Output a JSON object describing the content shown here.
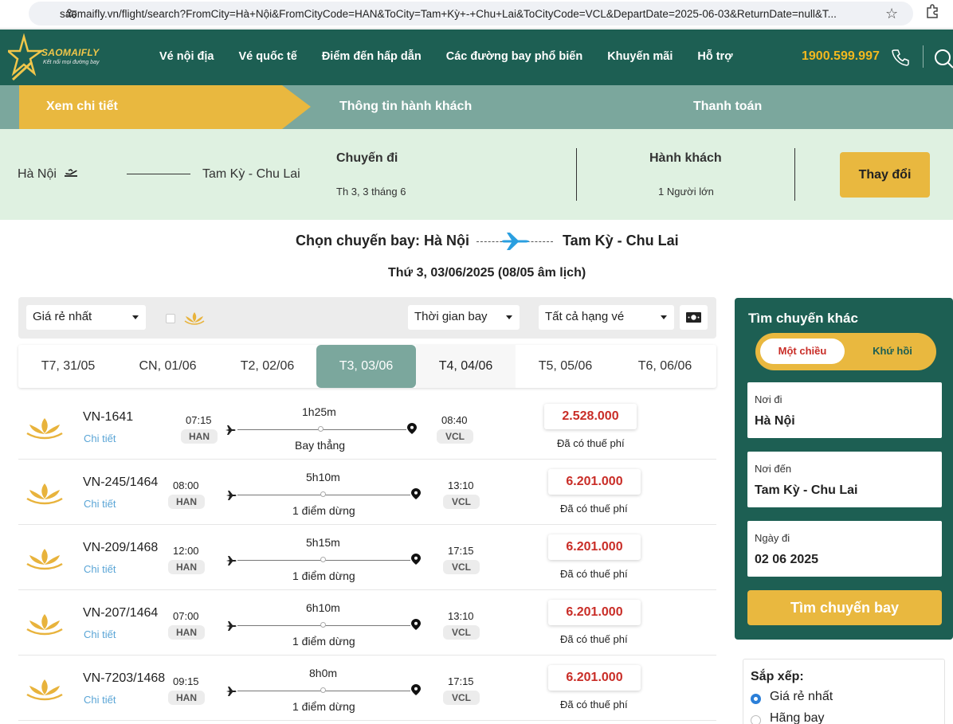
{
  "browser": {
    "url": "saomaifly.vn/flight/search?FromCity=Hà+Nội&FromCityCode=HAN&ToCity=Tam+Kỳ+-+Chu+Lai&ToCityCode=VCL&DepartDate=2025-06-03&ReturnDate=null&T..."
  },
  "header": {
    "brand": "SAOMAIFLY",
    "tagline": "Kết nối mọi đường bay",
    "menu": [
      "Vé nội địa",
      "Vé quốc tế",
      "Điểm đến hấp dẫn",
      "Các đường bay phổ biến",
      "Khuyến mãi",
      "Hỗ trợ"
    ],
    "hotline": "1900.599.997"
  },
  "steps": [
    "Xem chi tiết",
    "Thông tin hành khách",
    "Thanh toán"
  ],
  "summary": {
    "from": "Hà Nội",
    "to": "Tam Kỳ - Chu Lai",
    "trip_title": "Chuyến đi",
    "trip_date": "Th 3, 3 tháng 6",
    "pax_title": "Hành khách",
    "pax": "1 Người lớn",
    "change_label": "Thay đổi"
  },
  "heading": {
    "left": "Chọn chuyến bay: Hà Nội",
    "right": "Tam Kỳ - Chu Lai",
    "date": "Thứ 3, 03/06/2025 (08/05 âm lịch)"
  },
  "filters": {
    "sort": "Giá rẻ nhất",
    "time": "Thời gian bay",
    "class": "Tất cả hạng vé"
  },
  "dates": [
    "T7, 31/05",
    "CN, 01/06",
    "T2, 02/06",
    "T3, 03/06",
    "T4, 04/06",
    "T5, 05/06",
    "T6, 06/06"
  ],
  "flights": [
    {
      "code": "VN-1641",
      "detail": "Chi tiết",
      "dep_time": "07:15",
      "dep": "HAN",
      "duration": "1h25m",
      "stops": "Bay thẳng",
      "arr_time": "08:40",
      "arr": "VCL",
      "price": "2.528.000",
      "tax": "Đã có thuế phí"
    },
    {
      "code": "VN-245/1464",
      "detail": "Chi tiết",
      "dep_time": "08:00",
      "dep": "HAN",
      "duration": "5h10m",
      "stops": "1 điểm dừng",
      "arr_time": "13:10",
      "arr": "VCL",
      "price": "6.201.000",
      "tax": "Đã có thuế phí"
    },
    {
      "code": "VN-209/1468",
      "detail": "Chi tiết",
      "dep_time": "12:00",
      "dep": "HAN",
      "duration": "5h15m",
      "stops": "1 điểm dừng",
      "arr_time": "17:15",
      "arr": "VCL",
      "price": "6.201.000",
      "tax": "Đã có thuế phí"
    },
    {
      "code": "VN-207/1464",
      "detail": "Chi tiết",
      "dep_time": "07:00",
      "dep": "HAN",
      "duration": "6h10m",
      "stops": "1 điểm dừng",
      "arr_time": "13:10",
      "arr": "VCL",
      "price": "6.201.000",
      "tax": "Đã có thuế phí"
    },
    {
      "code": "VN-7203/1468",
      "detail": "Chi tiết",
      "dep_time": "09:15",
      "dep": "HAN",
      "duration": "8h0m",
      "stops": "1 điểm dừng",
      "arr_time": "17:15",
      "arr": "VCL",
      "price": "6.201.000",
      "tax": "Đã có thuế phí"
    }
  ],
  "panel": {
    "title": "Tìm chuyến khác",
    "one_way": "Một chiều",
    "round_trip": "Khứ hồi",
    "from_label": "Nơi đi",
    "from_value": "Hà Nội",
    "to_label": "Nơi đến",
    "to_value": "Tam Kỳ - Chu Lai",
    "date_label": "Ngày đi",
    "date_value": "02 06 2025",
    "search_label": "Tìm chuyến bay"
  },
  "sort_box": {
    "title": "Sắp xếp:",
    "options": [
      "Giá rẻ nhất",
      "Hãng bay"
    ]
  },
  "colors": {
    "brand_green": "#1d5f53",
    "accent_gold": "#e9b83f",
    "step_green": "#7ba79d",
    "summary_bg": "#dff1e1",
    "price_red": "#c92d27",
    "link_blue": "#5aa5d6"
  }
}
